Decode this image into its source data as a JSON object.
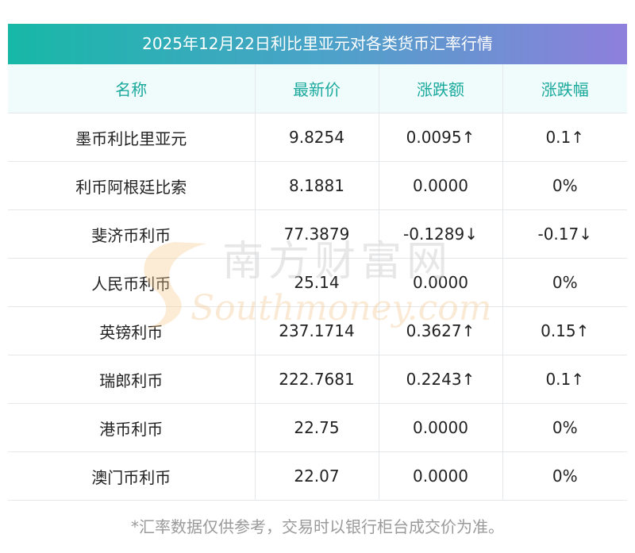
{
  "title": "2025年12月22日利比里亚元对各类货币汇率行情",
  "columns": [
    "名称",
    "最新价",
    "涨跌额",
    "涨跌幅"
  ],
  "rows": [
    {
      "name": "墨币利比里亚元",
      "price": "9.8254",
      "change": "0.0095↑",
      "change_pct": "0.1↑",
      "trend": "up"
    },
    {
      "name": "利币阿根廷比索",
      "price": "8.1881",
      "change": "0.0000",
      "change_pct": "0%",
      "trend": "flat"
    },
    {
      "name": "斐济币利币",
      "price": "77.3879",
      "change": "-0.1289↓",
      "change_pct": "-0.17↓",
      "trend": "down"
    },
    {
      "name": "人民币利币",
      "price": "25.14",
      "change": "0.0000",
      "change_pct": "0%",
      "trend": "flat"
    },
    {
      "name": "英镑利币",
      "price": "237.1714",
      "change": "0.3627↑",
      "change_pct": "0.15↑",
      "trend": "up"
    },
    {
      "name": "瑞郎利币",
      "price": "222.7681",
      "change": "0.2243↑",
      "change_pct": "0.1↑",
      "trend": "up"
    },
    {
      "name": "港币利币",
      "price": "22.75",
      "change": "0.0000",
      "change_pct": "0%",
      "trend": "flat"
    },
    {
      "name": "澳门币利币",
      "price": "22.07",
      "change": "0.0000",
      "change_pct": "0%",
      "trend": "flat"
    }
  ],
  "watermark": {
    "cn": "南方财富网",
    "en": "Southmoney.com"
  },
  "footnote": "*汇率数据仅供参考，交易时以银行柜台成交价为准。",
  "colors": {
    "up": "#ee1111",
    "down": "#1d8a1d",
    "flat": "#222222",
    "header_text": "#1aa99d"
  }
}
